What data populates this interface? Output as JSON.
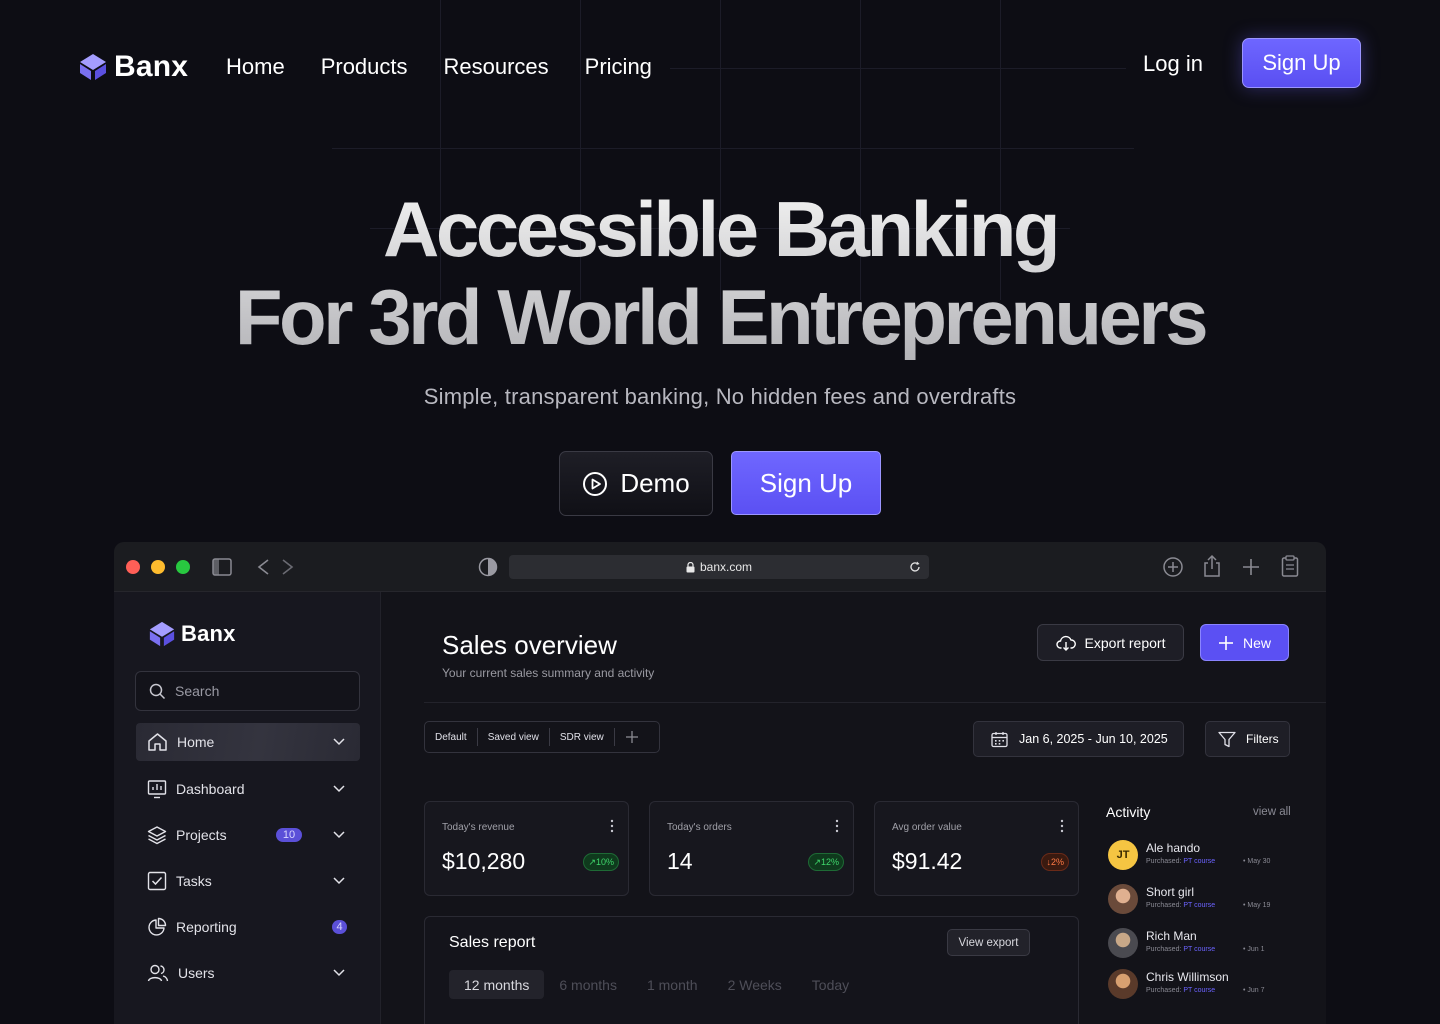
{
  "brand": {
    "name": "Banx",
    "accent": "#5b50f3",
    "logo_color": "#8b82ff"
  },
  "nav": {
    "links": [
      "Home",
      "Products",
      "Resources",
      "Pricing"
    ],
    "login": "Log in",
    "signup": "Sign Up"
  },
  "hero": {
    "title_line1": "Accessible Banking",
    "title_line2": "For 3rd World Entreprenuers",
    "subtitle": "Simple, transparent banking, No hidden fees and overdrafts",
    "demo_label": "Demo",
    "signup_label": "Sign Up"
  },
  "browser": {
    "url": "banx.com",
    "traffic_lights": [
      "#ff5f57",
      "#febc2e",
      "#28c840"
    ]
  },
  "app": {
    "brand": "Banx",
    "search_placeholder": "Search",
    "sidebar": [
      {
        "label": "Home",
        "icon": "home-icon",
        "active": true,
        "chevron": true
      },
      {
        "label": "Dashboard",
        "icon": "dashboard-icon",
        "chevron": true
      },
      {
        "label": "Projects",
        "icon": "layers-icon",
        "badge": "10",
        "chevron": true
      },
      {
        "label": "Tasks",
        "icon": "checkbox-icon",
        "chevron": true
      },
      {
        "label": "Reporting",
        "icon": "pie-chart-icon",
        "badge": "4"
      },
      {
        "label": "Users",
        "icon": "users-icon",
        "chevron": true
      }
    ],
    "page_title": "Sales overview",
    "page_subtitle": "Your current sales summary and activity",
    "export_label": "Export report",
    "new_label": "New",
    "views": [
      "Default",
      "Saved view",
      "SDR view"
    ],
    "date_range": "Jan 6, 2025 - Jun 10, 2025",
    "filters_label": "Filters",
    "kpis": [
      {
        "label": "Today's revenue",
        "value": "$10,280",
        "delta": "10%",
        "direction": "up"
      },
      {
        "label": "Today's orders",
        "value": "14",
        "delta": "12%",
        "direction": "up"
      },
      {
        "label": "Avg order value",
        "value": "$91.42",
        "delta": "2%",
        "direction": "down"
      }
    ],
    "report": {
      "title": "Sales report",
      "view_export": "View export",
      "tabs": [
        "12 months",
        "6 months",
        "1 month",
        "2 Weeks",
        "Today"
      ],
      "active_tab": "12 months"
    },
    "activity": {
      "title": "Activity",
      "view_all": "view all",
      "purchased_prefix": "Purchased:",
      "items": [
        {
          "name": "Ale hando",
          "initials": "JT",
          "product": "PT course",
          "date": "May 30"
        },
        {
          "name": "Short girl",
          "product": "PT course",
          "date": "May 19"
        },
        {
          "name": "Rich Man",
          "product": "PT course",
          "date": "Jun 1"
        },
        {
          "name": "Chris Willimson",
          "product": "PT course",
          "date": "Jun 7"
        }
      ]
    }
  }
}
